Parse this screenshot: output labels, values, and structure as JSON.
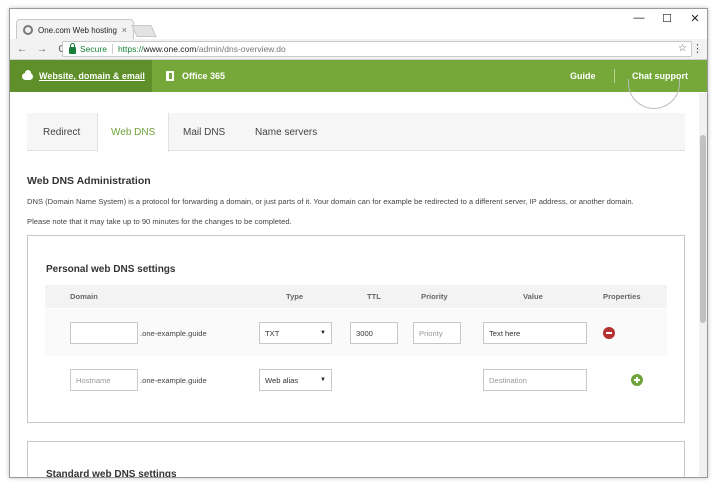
{
  "browser": {
    "tab_title": "One.com Web hosting",
    "tab_close": "×",
    "secure_label": "Secure",
    "url_scheme": "https://",
    "url_host": "www.one.com",
    "url_path": "/admin/dns-overview.do",
    "nav_back": "←",
    "nav_forward": "→",
    "nav_reload": "C",
    "star": "☆",
    "menu": "⋮",
    "win_minimize": "—",
    "win_maximize": "☐",
    "win_close": "✕"
  },
  "sitenav": {
    "website_label": "Website, domain & email",
    "office_label": "Office 365",
    "guide_label": "Guide",
    "chat_label": "Chat support"
  },
  "tabs": [
    {
      "label": "Redirect"
    },
    {
      "label": "Web DNS"
    },
    {
      "label": "Mail DNS"
    },
    {
      "label": "Name servers"
    }
  ],
  "admin": {
    "title": "Web DNS Administration",
    "description": "DNS (Domain Name System) is a protocol for forwarding a domain, or just parts of it. Your domain can for example be redirected to a different server, IP address, or another domain.",
    "note": "Please note that it may take up to 90 minutes for the changes to be completed."
  },
  "personal": {
    "title": "Personal web DNS settings",
    "columns": {
      "domain": "Domain",
      "type": "Type",
      "ttl": "TTL",
      "priority": "Priority",
      "value": "Value",
      "properties": "Properties"
    },
    "row1": {
      "domain_value": "",
      "suffix": ".one-example.guide",
      "type": "TXT",
      "ttl": "3000",
      "priority_placeholder": "Priority",
      "value": "Text here"
    },
    "row2": {
      "hostname_placeholder": "Hostname",
      "suffix": ".one-example.guide",
      "type": "Web alias",
      "value_placeholder": "Destination"
    }
  },
  "standard": {
    "title": "Standard web DNS settings"
  },
  "colors": {
    "brand_green": "#76a839",
    "brand_green_dark": "#5e8f28",
    "remove_red": "#b53232"
  }
}
